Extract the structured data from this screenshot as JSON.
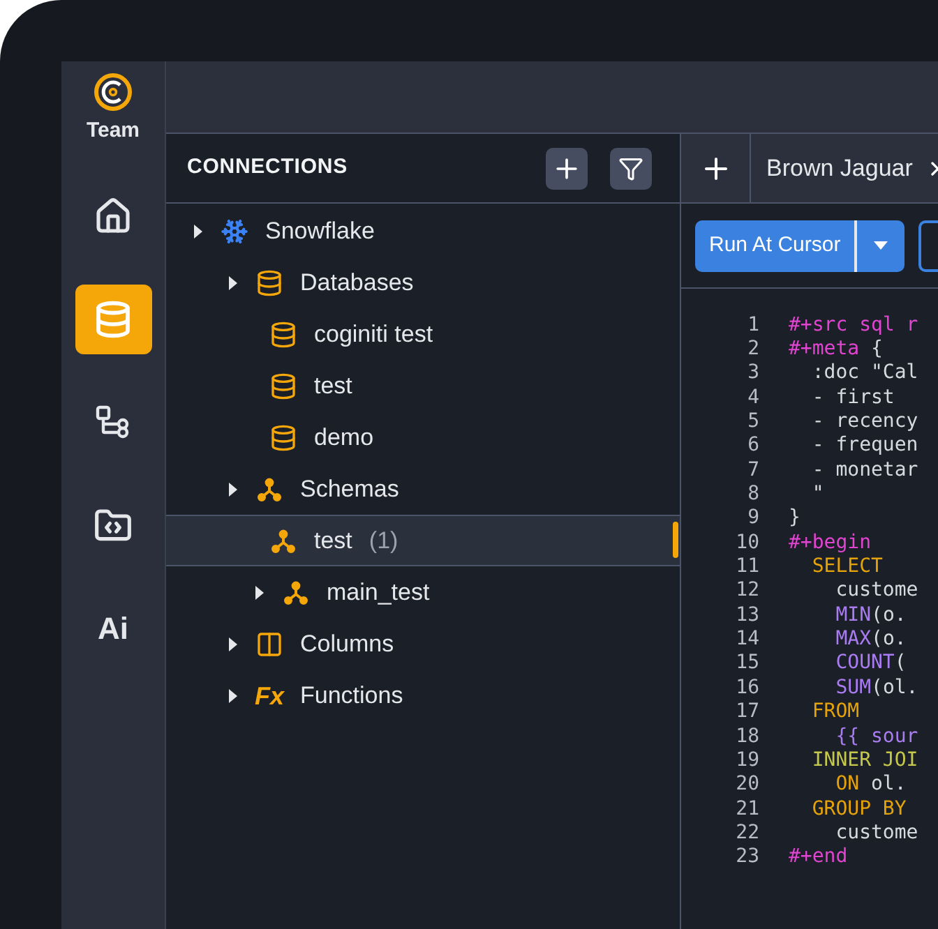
{
  "rail": {
    "team_label": "Team",
    "items": [
      {
        "selected": false
      },
      {
        "selected": true
      },
      {
        "selected": false
      },
      {
        "selected": false
      },
      {
        "label": "Ai",
        "selected": false
      }
    ]
  },
  "connections": {
    "title": "CONNECTIONS",
    "tree": [
      {
        "label": "Snowflake",
        "kind": "snowflake",
        "expandable": true,
        "selected": false,
        "children": [
          {
            "label": "Databases",
            "kind": "database",
            "expandable": true,
            "selected": false,
            "children": [
              {
                "label": "coginiti test",
                "kind": "database",
                "expandable": false,
                "selected": false
              },
              {
                "label": "test",
                "kind": "database",
                "expandable": false,
                "selected": false
              },
              {
                "label": "demo",
                "kind": "database",
                "expandable": false,
                "selected": false
              }
            ]
          },
          {
            "label": "Schemas",
            "kind": "schema",
            "expandable": true,
            "selected": false,
            "children": [
              {
                "label": "test",
                "count": "(1)",
                "kind": "schema",
                "expandable": false,
                "selected": true
              },
              {
                "label": "main_test",
                "kind": "schema",
                "expandable": true,
                "selected": false
              }
            ]
          },
          {
            "label": "Columns",
            "kind": "columns",
            "expandable": true,
            "selected": false
          },
          {
            "label": "Functions",
            "kind": "function",
            "icon_glyph": "Fx",
            "expandable": true,
            "selected": false
          }
        ]
      }
    ]
  },
  "editor": {
    "tabs": [
      {
        "label": "Brown Jaguar",
        "selected": true
      }
    ],
    "run_button": "Run At Cursor",
    "lines": [
      {
        "n": "1",
        "tokens": [
          {
            "t": "#+src sql r",
            "kind": "meta"
          }
        ]
      },
      {
        "n": "2",
        "tokens": [
          {
            "t": "#+meta",
            "kind": "meta"
          },
          {
            "t": " {",
            "kind": "plain"
          }
        ]
      },
      {
        "n": "3",
        "tokens": [
          {
            "t": "  :doc \"Cal",
            "kind": "plain"
          }
        ]
      },
      {
        "n": "4",
        "tokens": [
          {
            "t": "  - first",
            "kind": "plain"
          }
        ]
      },
      {
        "n": "5",
        "tokens": [
          {
            "t": "  - recency",
            "kind": "plain"
          }
        ]
      },
      {
        "n": "6",
        "tokens": [
          {
            "t": "  - frequen",
            "kind": "plain"
          }
        ]
      },
      {
        "n": "7",
        "tokens": [
          {
            "t": "  - monetar",
            "kind": "plain"
          }
        ]
      },
      {
        "n": "8",
        "tokens": [
          {
            "t": "  \"",
            "kind": "plain"
          }
        ]
      },
      {
        "n": "9",
        "tokens": [
          {
            "t": "}",
            "kind": "plain"
          }
        ]
      },
      {
        "n": "10",
        "tokens": [
          {
            "t": "#+begin",
            "kind": "meta"
          }
        ]
      },
      {
        "n": "11",
        "tokens": [
          {
            "t": "  SELECT",
            "kind": "keyword"
          }
        ]
      },
      {
        "n": "12",
        "tokens": [
          {
            "t": "    custome",
            "kind": "plain"
          }
        ]
      },
      {
        "n": "13",
        "tokens": [
          {
            "t": "    MIN",
            "kind": "function"
          },
          {
            "t": "(o.",
            "kind": "plain"
          }
        ]
      },
      {
        "n": "14",
        "tokens": [
          {
            "t": "    MAX",
            "kind": "function"
          },
          {
            "t": "(o.",
            "kind": "plain"
          }
        ]
      },
      {
        "n": "15",
        "tokens": [
          {
            "t": "    COUNT",
            "kind": "function"
          },
          {
            "t": "(",
            "kind": "plain"
          }
        ]
      },
      {
        "n": "16",
        "tokens": [
          {
            "t": "    SUM",
            "kind": "function"
          },
          {
            "t": "(ol.",
            "kind": "plain"
          }
        ]
      },
      {
        "n": "17",
        "tokens": [
          {
            "t": "  FROM",
            "kind": "keyword"
          }
        ]
      },
      {
        "n": "18",
        "tokens": [
          {
            "t": "    {{ sour",
            "kind": "template"
          }
        ]
      },
      {
        "n": "19",
        "tokens": [
          {
            "t": "  INNER JOI",
            "kind": "join"
          }
        ]
      },
      {
        "n": "20",
        "tokens": [
          {
            "t": "    ON",
            "kind": "keyword"
          },
          {
            "t": " ol.",
            "kind": "plain"
          }
        ]
      },
      {
        "n": "21",
        "tokens": [
          {
            "t": "  GROUP BY",
            "kind": "keyword"
          }
        ]
      },
      {
        "n": "22",
        "tokens": [
          {
            "t": "    custome",
            "kind": "plain"
          }
        ]
      },
      {
        "n": "23",
        "tokens": [
          {
            "t": "#+end",
            "kind": "meta"
          }
        ]
      }
    ]
  }
}
